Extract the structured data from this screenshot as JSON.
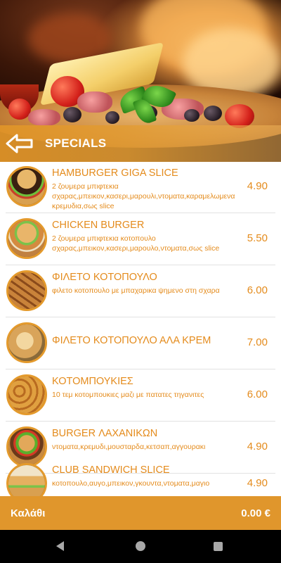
{
  "header": {
    "title": "SPECIALS",
    "back_icon": "back-arrow-icon"
  },
  "menu": {
    "items": [
      {
        "name": "HAMBURGER GIGA SLICE",
        "description": " 2 ζουμερα μπιφτεκια σχαρας,μπεικον,κασερι,μαρουλι,ντοματα,καραμελωμενα κρεμυδια,σως slice",
        "price": "4.90",
        "thumb": "hamburger"
      },
      {
        "name": "CHICKEN BURGER",
        "description": " 2 ζουμερα μπιφτεκια κοτοπουλο σχαρας,μπεικον,κασερι,μαρουλο,ντοματα,σως slice",
        "price": "5.50",
        "thumb": "chicken-burger"
      },
      {
        "name": "ΦΙΛΕΤΟ ΚΟΤΟΠΟΥΛΟ",
        "description": " φιλετο κοτοπουλο με μπαχαρικα  ψημενο στη σχαρα",
        "price": "6.00",
        "thumb": "grilled-chicken"
      },
      {
        "name": "ΦΙΛΕΤΟ ΚΟΤΟΠΟΥΛΟ ΑΛΑ ΚΡΕΜ",
        "description": "",
        "price": "7.00",
        "thumb": "chicken-cream"
      },
      {
        "name": "ΚΟΤΟΜΠΟΥΚΙΕΣ",
        "description": " 10 τεμ κοτομπουκιες μαζι με πατατες τηγανιτες",
        "price": "6.00",
        "thumb": "nuggets"
      },
      {
        "name": "BURGER ΛΑΧΑΝΙΚΩΝ",
        "description": " ντοματα,κρεμυδι,μουσταρδα,κετσαπ,αγγουρακι",
        "price": "4.90",
        "thumb": "veggie-burger"
      },
      {
        "name": "CLUB SANDWICH SLICE",
        "description": " κοτοπουλο,αυγο,μπεικον,γκουντα,ντοματα,μαγιο",
        "price": "4.90",
        "thumb": "club-sandwich"
      }
    ]
  },
  "cart": {
    "label": "Καλάθι",
    "total": "0.00 €"
  },
  "colors": {
    "accent": "#e48b1c",
    "bar": "#e0962c"
  }
}
